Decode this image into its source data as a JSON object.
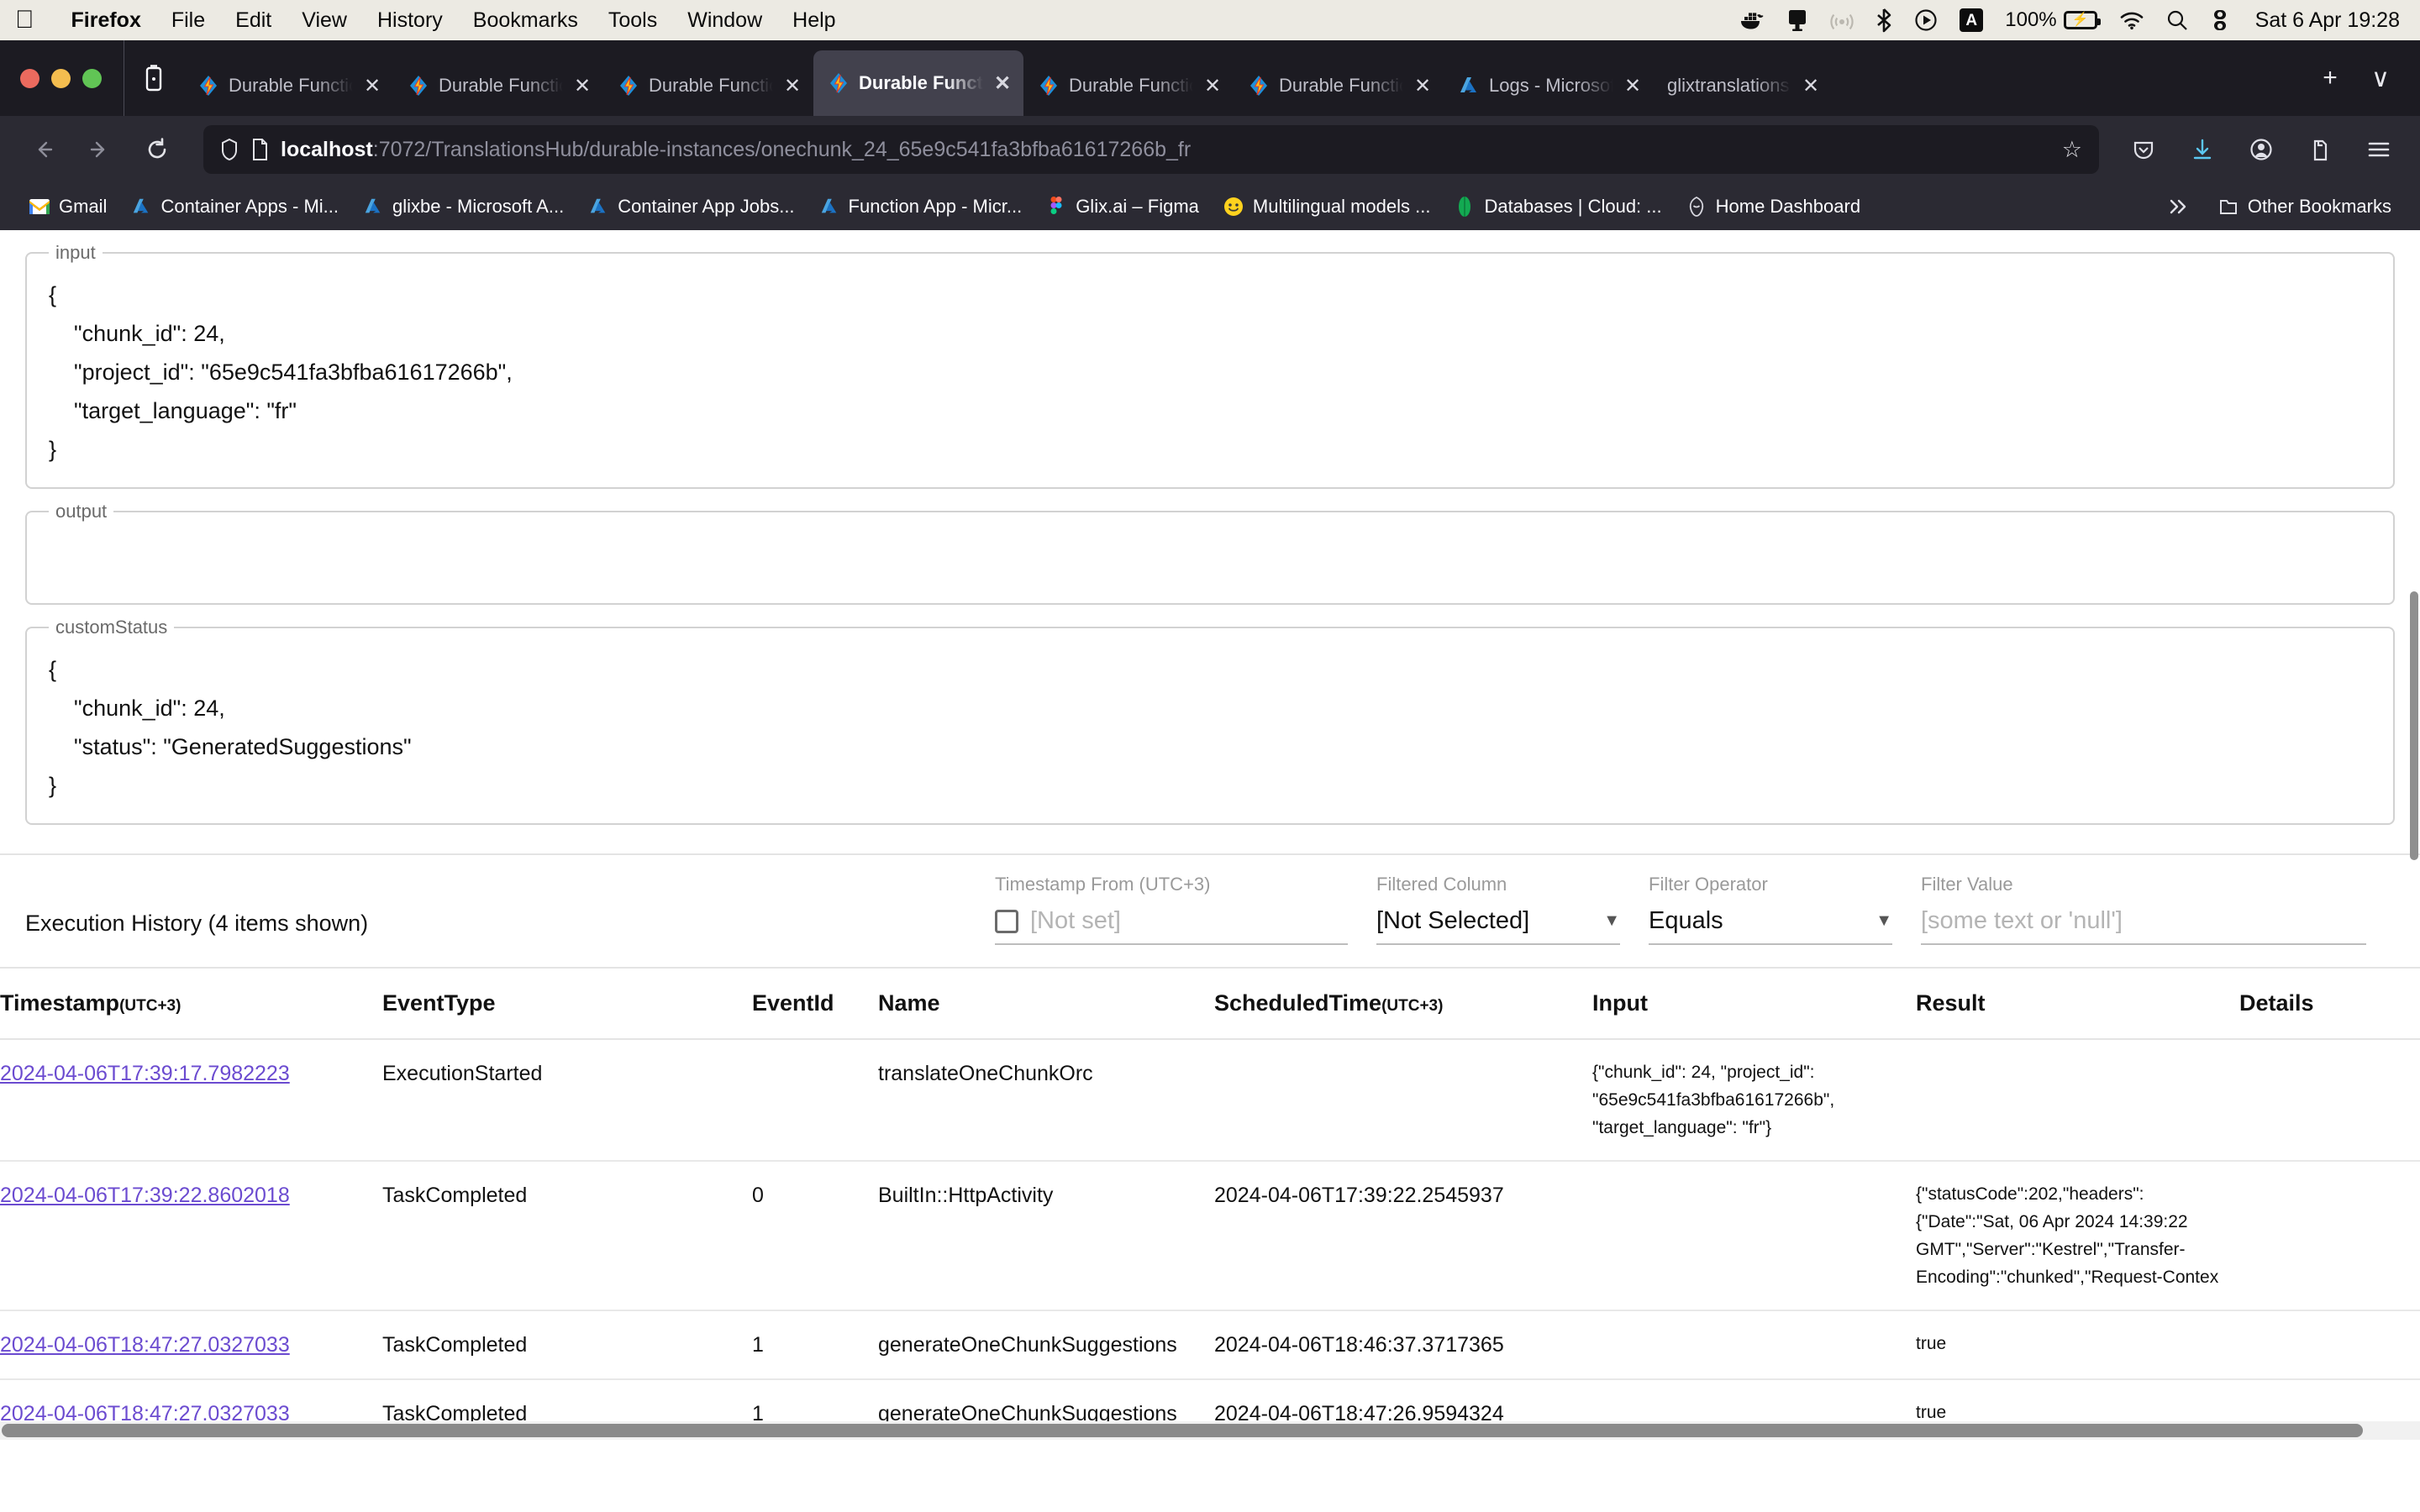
{
  "os_menu": {
    "apple_icon": "apple-icon",
    "items": [
      {
        "label": "Firefox",
        "bold": true
      },
      {
        "label": "File",
        "bold": false
      },
      {
        "label": "Edit",
        "bold": false
      },
      {
        "label": "View",
        "bold": false
      },
      {
        "label": "History",
        "bold": false
      },
      {
        "label": "Bookmarks",
        "bold": false
      },
      {
        "label": "Tools",
        "bold": false
      },
      {
        "label": "Window",
        "bold": false
      },
      {
        "label": "Help",
        "bold": false
      }
    ],
    "status_icons": [
      "docker-icon",
      "display-icon",
      "airplay-icon",
      "bluetooth-icon",
      "play-circle-icon",
      "input-source-icon",
      "battery-icon",
      "wifi-icon",
      "search-icon",
      "control-center-icon"
    ],
    "input_source": "A",
    "battery_percent": "100%",
    "clock": "Sat 6 Apr  19:28"
  },
  "browser": {
    "window_controls": [
      "close",
      "minimize",
      "zoom"
    ],
    "firefox_view_icon": "firefox-view-icon",
    "tabs": [
      {
        "title": "Durable Function",
        "favicon": "azure-functions-icon",
        "active": false
      },
      {
        "title": "Durable Function",
        "favicon": "azure-functions-icon",
        "active": false
      },
      {
        "title": "Durable Function",
        "favicon": "azure-functions-icon",
        "active": false
      },
      {
        "title": "Durable Function",
        "favicon": "azure-functions-icon",
        "active": true
      },
      {
        "title": "Durable Function",
        "favicon": "azure-functions-icon",
        "active": false
      },
      {
        "title": "Durable Function",
        "favicon": "azure-functions-icon",
        "active": false
      },
      {
        "title": "Logs - Microsoft",
        "favicon": "azure-icon",
        "active": false
      },
      {
        "title": "glixtranslations.azure",
        "favicon": "none",
        "active": false
      }
    ],
    "new_tab_label": "+",
    "list_all_tabs_label": "∨",
    "nav": {
      "back_icon": "back-arrow-icon",
      "forward_icon": "forward-arrow-icon",
      "reload_icon": "reload-icon",
      "shield_icon": "shield-icon",
      "page_icon": "page-icon",
      "url_host": "localhost",
      "url_rest": ":7072/TranslationsHub/durable-instances/onechunk_24_65e9c541fa3bfba61617266b_fr",
      "bookmark_star_icon": "star-icon",
      "right_icons": [
        "pocket-icon",
        "downloads-icon",
        "account-icon",
        "extensions-icon",
        "app-menu-icon"
      ]
    },
    "bookmarks": [
      {
        "label": "Gmail",
        "icon": "gmail-icon"
      },
      {
        "label": "Container Apps - Mi...",
        "icon": "azure-icon"
      },
      {
        "label": "glixbe - Microsoft A...",
        "icon": "azure-icon"
      },
      {
        "label": "Container App Jobs...",
        "icon": "azure-icon"
      },
      {
        "label": "Function App - Micr...",
        "icon": "azure-icon"
      },
      {
        "label": "Glix.ai – Figma",
        "icon": "figma-icon"
      },
      {
        "label": "Multilingual models ...",
        "icon": "huggingface-icon"
      },
      {
        "label": "Databases | Cloud: ...",
        "icon": "mongodb-icon"
      },
      {
        "label": "Home Dashboard",
        "icon": "grafana-icon"
      }
    ],
    "bookmarks_overflow_icon": "chevron-double-right-icon",
    "other_bookmarks": {
      "label": "Other Bookmarks",
      "icon": "folder-icon"
    }
  },
  "content": {
    "input": {
      "legend": "input",
      "value": "{\n    \"chunk_id\": 24,\n    \"project_id\": \"65e9c541fa3bfba61617266b\",\n    \"target_language\": \"fr\"\n}"
    },
    "output": {
      "legend": "output",
      "value": ""
    },
    "custom_status": {
      "legend": "customStatus",
      "value": "{\n    \"chunk_id\": 24,\n    \"status\": \"GeneratedSuggestions\"\n}"
    },
    "history": {
      "title": "Execution History (4 items shown)",
      "filters": {
        "timestamp_from": {
          "label": "Timestamp From (UTC+3)",
          "value": "[Not set]",
          "checkbox_checked": false
        },
        "filtered_column": {
          "label": "Filtered Column",
          "value": "[Not Selected]"
        },
        "filter_operator": {
          "label": "Filter Operator",
          "value": "Equals"
        },
        "filter_value": {
          "label": "Filter Value",
          "placeholder": "[some text or 'null']",
          "value": ""
        }
      },
      "columns": [
        {
          "label": "Timestamp",
          "sub": "(UTC+3)"
        },
        {
          "label": "EventType",
          "sub": ""
        },
        {
          "label": "EventId",
          "sub": ""
        },
        {
          "label": "Name",
          "sub": ""
        },
        {
          "label": "ScheduledTime",
          "sub": "(UTC+3)"
        },
        {
          "label": "Input",
          "sub": ""
        },
        {
          "label": "Result",
          "sub": ""
        },
        {
          "label": "Details",
          "sub": ""
        }
      ],
      "rows": [
        {
          "timestamp": "2024-04-06T17:39:17.7982223",
          "event_type": "ExecutionStarted",
          "event_id": "",
          "name": "translateOneChunkOrc",
          "scheduled_time": "",
          "input": "{\"chunk_id\": 24, \"project_id\": \"65e9c541fa3bfba61617266b\", \"target_language\": \"fr\"}",
          "result": "",
          "details": ""
        },
        {
          "timestamp": "2024-04-06T17:39:22.8602018",
          "event_type": "TaskCompleted",
          "event_id": "0",
          "name": "BuiltIn::HttpActivity",
          "scheduled_time": "2024-04-06T17:39:22.2545937",
          "input": "",
          "result": "{\"statusCode\":202,\"headers\":{\"Date\":\"Sat, 06 Apr 2024 14:39:22 GMT\",\"Server\":\"Kestrel\",\"Transfer-Encoding\":\"chunked\",\"Request-Contex",
          "details": ""
        },
        {
          "timestamp": "2024-04-06T18:47:27.0327033",
          "event_type": "TaskCompleted",
          "event_id": "1",
          "name": "generateOneChunkSuggestions",
          "scheduled_time": "2024-04-06T18:46:37.3717365",
          "input": "",
          "result": "true",
          "details": ""
        },
        {
          "timestamp": "2024-04-06T18:47:27.0327033",
          "event_type": "TaskCompleted",
          "event_id": "1",
          "name": "generateOneChunkSuggestions",
          "scheduled_time": "2024-04-06T18:47:26.9594324",
          "input": "",
          "result": "true",
          "details": ""
        }
      ]
    }
  },
  "colors": {
    "link": "#6b4bd0",
    "chrome_bg": "#2b2a33",
    "tabbar_bg": "#1c1b22",
    "active_tab": "#42414d",
    "menubar_bg": "#eceae3"
  }
}
